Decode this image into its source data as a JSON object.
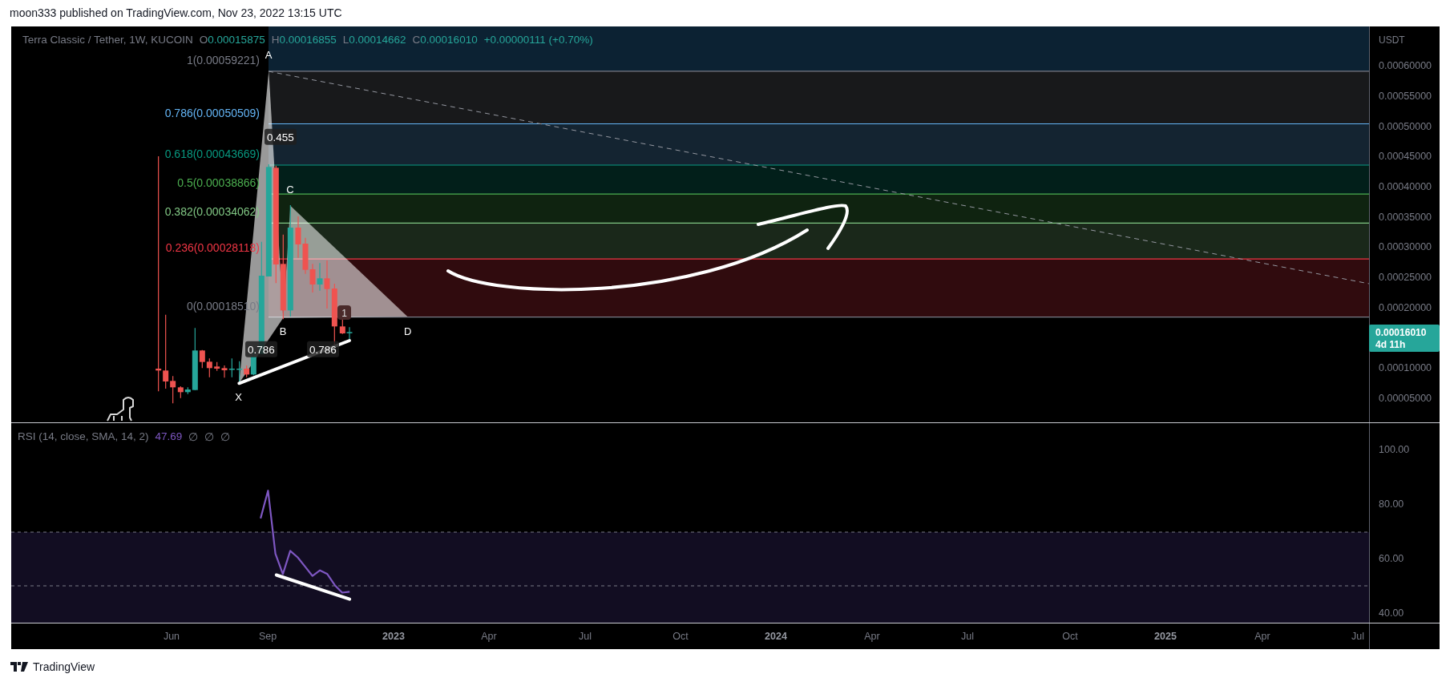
{
  "header": {
    "publisher": "moon333 published on TradingView.com, Nov 23, 2022 13:15 UTC"
  },
  "legend": {
    "symbol": "Terra Classic / Tether, 1W, KUCOIN",
    "values": [
      {
        "label": "O",
        "value": "0.00015875"
      },
      {
        "label": "H",
        "value": "0.00016855"
      },
      {
        "label": "L",
        "value": "0.00014662"
      },
      {
        "label": "C",
        "value": "0.00016010"
      }
    ],
    "change": "+0.00000111 (+0.70%)"
  },
  "fib_levels": [
    {
      "label": "1(0.00059221)",
      "color": "#787b86"
    },
    {
      "label": "0.786(0.00050509)",
      "color": "#64b5f6"
    },
    {
      "label": "0.618(0.00043669)",
      "color": "#089981"
    },
    {
      "label": "0.5(0.00038866)",
      "color": "#4caf50"
    },
    {
      "label": "0.382(0.00034062)",
      "color": "#81c784"
    },
    {
      "label": "0.236(0.00028118)",
      "color": "#f23645"
    },
    {
      "label": "0(0.00018510)",
      "color": "#787b86"
    }
  ],
  "pattern": {
    "points": [
      "X",
      "A",
      "B",
      "C",
      "D"
    ],
    "ratios": [
      "0.455",
      "0.786",
      "0.786"
    ],
    "badge": "1"
  },
  "price_axis": {
    "unit": "USDT",
    "labels": [
      "0.00060000",
      "0.00055000",
      "0.00050000",
      "0.00045000",
      "0.00040000",
      "0.00035000",
      "0.00030000",
      "0.00025000",
      "0.00020000",
      "0.00010000",
      "0.00005000"
    ],
    "current_price": "0.00016010",
    "countdown": "4d 11h"
  },
  "rsi": {
    "title": "RSI (14, close, SMA, 14, 2)",
    "value": "47.69",
    "extras": [
      "∅",
      "∅",
      "∅"
    ],
    "axis": [
      "100.00",
      "80.00",
      "60.00",
      "40.00"
    ]
  },
  "time_axis": [
    {
      "label": "Jun",
      "kind": "month"
    },
    {
      "label": "Sep",
      "kind": "month"
    },
    {
      "label": "2023",
      "kind": "year"
    },
    {
      "label": "Apr",
      "kind": "month"
    },
    {
      "label": "Jul",
      "kind": "month"
    },
    {
      "label": "Oct",
      "kind": "month"
    },
    {
      "label": "2024",
      "kind": "year"
    },
    {
      "label": "Apr",
      "kind": "month"
    },
    {
      "label": "Jul",
      "kind": "month"
    },
    {
      "label": "Oct",
      "kind": "month"
    },
    {
      "label": "2025",
      "kind": "year"
    },
    {
      "label": "Apr",
      "kind": "month"
    },
    {
      "label": "Jul",
      "kind": "month"
    }
  ],
  "footer": {
    "brand": "TradingView"
  }
}
